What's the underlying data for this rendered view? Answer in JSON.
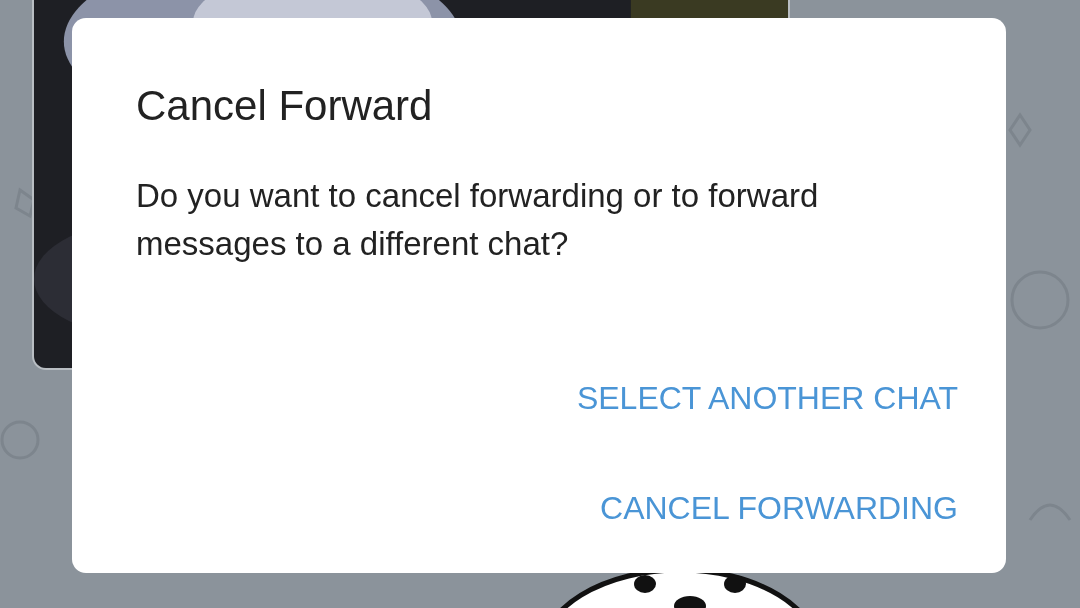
{
  "dialog": {
    "title": "Cancel Forward",
    "message": "Do you want to cancel forwarding or to forward messages to a different chat?",
    "buttons": [
      "SELECT ANOTHER CHAT",
      "CANCEL FORWARDING"
    ]
  }
}
